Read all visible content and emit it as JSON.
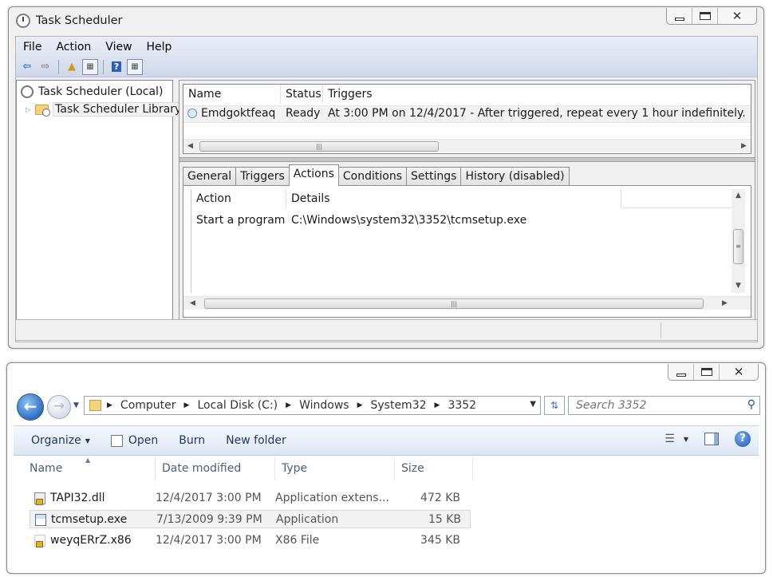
{
  "task_scheduler": {
    "title": "Task Scheduler",
    "menu": [
      "File",
      "Action",
      "View",
      "Help"
    ],
    "tree": {
      "root": "Task Scheduler (Local)",
      "child": "Task Scheduler Library"
    },
    "task_table": {
      "headers": [
        "Name",
        "Status",
        "Triggers"
      ],
      "rows": [
        {
          "name": "Emdgoktfeaq",
          "status": "Ready",
          "triggers": "At 3:00 PM on 12/4/2017 - After triggered, repeat every 1 hour indefinitely."
        }
      ]
    },
    "tabs": [
      "General",
      "Triggers",
      "Actions",
      "Conditions",
      "Settings",
      "History (disabled)"
    ],
    "active_tab": "Actions",
    "actions_table": {
      "headers": [
        "Action",
        "Details"
      ],
      "rows": [
        {
          "action": "Start a program",
          "details": "C:\\Windows\\system32\\3352\\tcmsetup.exe"
        }
      ]
    }
  },
  "explorer": {
    "breadcrumb": [
      "Computer",
      "Local Disk (C:)",
      "Windows",
      "System32",
      "3352"
    ],
    "search_placeholder": "Search 3352",
    "commands": {
      "organize": "Organize",
      "open": "Open",
      "burn": "Burn",
      "new_folder": "New folder"
    },
    "columns": [
      "Name",
      "Date modified",
      "Type",
      "Size"
    ],
    "files": [
      {
        "name": "TAPI32.dll",
        "date": "12/4/2017 3:00 PM",
        "type": "Application extens...",
        "size": "472 KB",
        "icon": "dll-locked-icon"
      },
      {
        "name": "tcmsetup.exe",
        "date": "7/13/2009 9:39 PM",
        "type": "Application",
        "size": "15 KB",
        "icon": "exe-icon"
      },
      {
        "name": "weyqERrZ.x86",
        "date": "12/4/2017 3:00 PM",
        "type": "X86 File",
        "size": "345 KB",
        "icon": "locked-file-icon"
      }
    ],
    "selected_file": "tcmsetup.exe"
  }
}
